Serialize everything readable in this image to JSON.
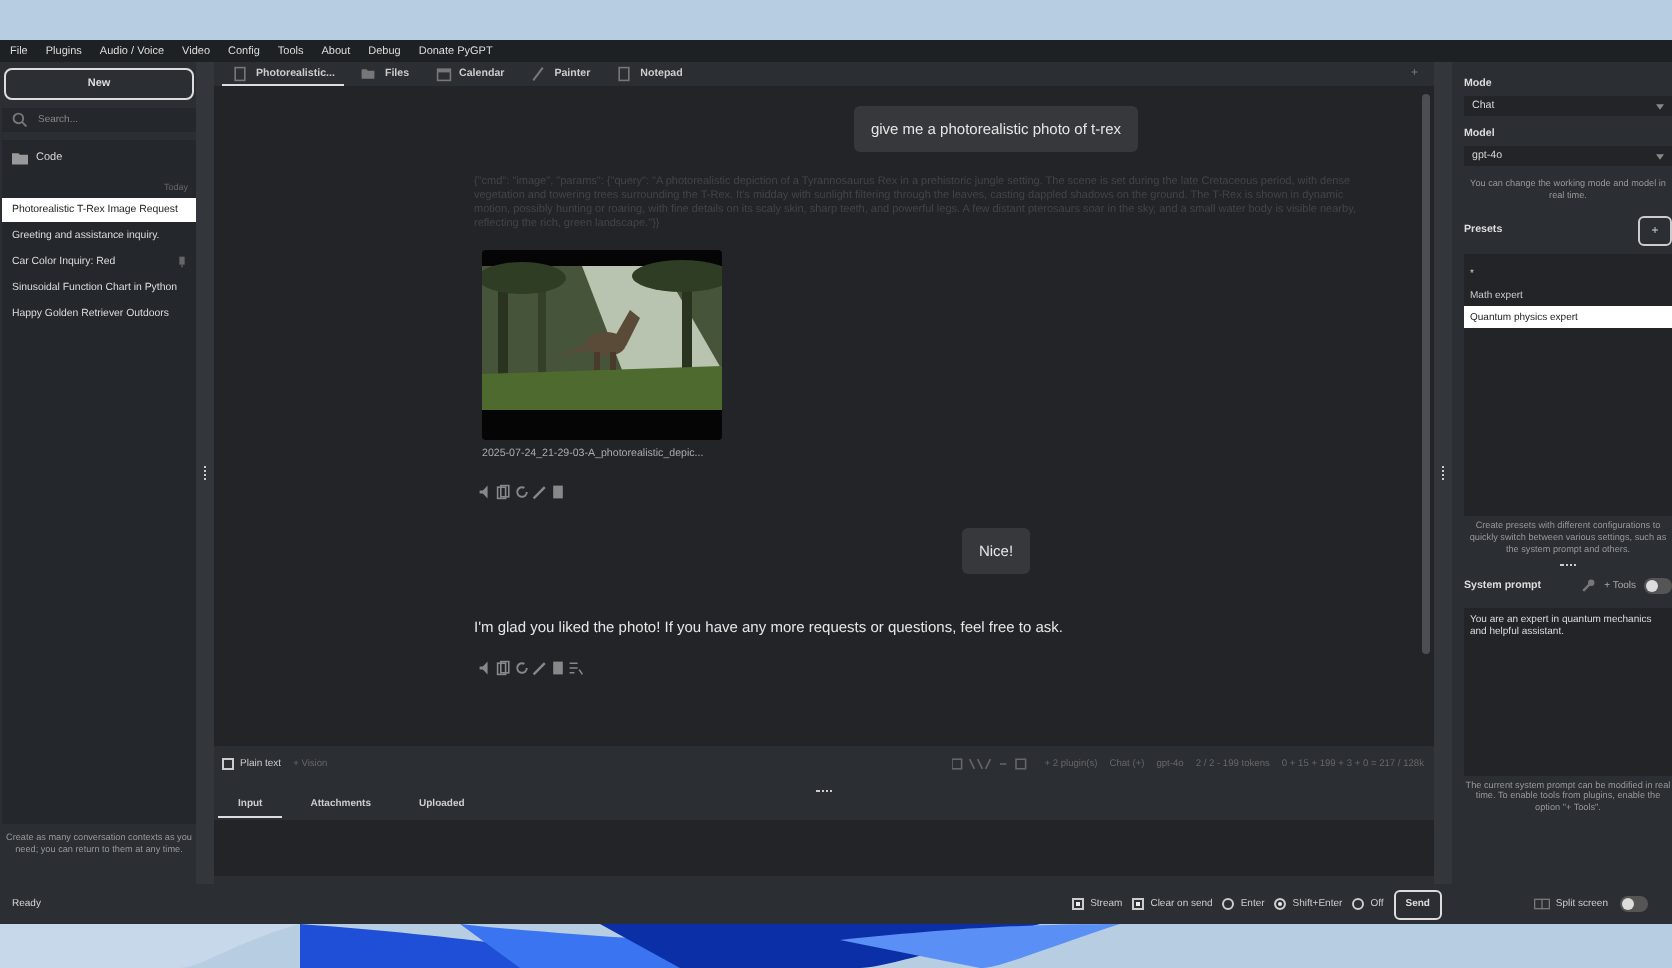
{
  "menu": [
    "File",
    "Plugins",
    "Audio / Voice",
    "Video",
    "Config",
    "Tools",
    "About",
    "Debug",
    "Donate PyGPT"
  ],
  "sidebar": {
    "new_button": "New",
    "search": {
      "placeholder": "Search..."
    },
    "folder": "Code",
    "group_label": "Today",
    "items": [
      {
        "title": "Photorealistic T-Rex Image Request",
        "selected": true,
        "pinned": false
      },
      {
        "title": "Greeting and assistance inquiry.",
        "selected": false,
        "pinned": false
      },
      {
        "title": "Car Color Inquiry: Red",
        "selected": false,
        "pinned": true
      },
      {
        "title": "Sinusoidal Function Chart in Python",
        "selected": false,
        "pinned": false
      },
      {
        "title": "Happy Golden Retriever Outdoors",
        "selected": false,
        "pinned": false
      }
    ],
    "footer": "Create as many conversation contexts as you need; you can return to them at any time."
  },
  "tabs": [
    {
      "label": "Photorealistic...",
      "kind": "chat",
      "selected": true
    },
    {
      "label": "Files",
      "kind": "folder",
      "selected": false
    },
    {
      "label": "Calendar",
      "kind": "calendar",
      "selected": false
    },
    {
      "label": "Painter",
      "kind": "brush",
      "selected": false
    },
    {
      "label": "Notepad",
      "kind": "note",
      "selected": false
    }
  ],
  "tab_add": "+",
  "messages": [
    {
      "kind": "user",
      "text": "give me a photorealistic photo of t-rex"
    },
    {
      "kind": "command",
      "text": "{\"cmd\": \"image\", \"params\": {\"query\": \"A photorealistic depiction of a Tyrannosaurus Rex in a prehistoric jungle setting. The scene is set during the late Cretaceous period, with dense vegetation and towering trees surrounding the T-Rex. It's midday with sunlight filtering through the leaves, casting dappled shadows on the ground. The T-Rex is shown in dynamic motion, possibly hunting or roaring, with fine details on its scaly skin, sharp teeth, and powerful legs. A few distant pterosaurs soar in the sky, and a small water body is visible nearby, reflecting the rich, green landscape.\"}}"
    },
    {
      "caption": "2025-07-24_21-29-03-A_photorealistic_depic...",
      "actions": [
        {
          "kind": "speaker"
        },
        {
          "kind": "copy"
        },
        {
          "kind": "reload"
        },
        {
          "kind": "edit"
        },
        {
          "kind": "delete"
        }
      ]
    },
    {
      "kind": "user",
      "text": "Nice!"
    },
    {
      "kind": "assistant",
      "text": "I'm glad you liked the photo! If you have any more requests or questions, feel free to ask.",
      "actions": [
        {
          "kind": "speaker"
        },
        {
          "kind": "copy"
        },
        {
          "kind": "reload"
        },
        {
          "kind": "edit"
        },
        {
          "kind": "delete"
        },
        {
          "kind": "text"
        }
      ]
    }
  ],
  "toolbar": {
    "plain_text": {
      "label": "Plain text",
      "checked": false
    },
    "vision": "+ Vision",
    "plugins": "+ 2 plugin(s)",
    "mode": "Chat (+)",
    "model": "gpt-4o",
    "tokens": "2 / 2 - 199 tokens",
    "usage": "0 + 15 + 199 + 3 + 0 = 217 / 128k"
  },
  "input_tabs": [
    {
      "label": "Input",
      "selected": true
    },
    {
      "label": "Attachments",
      "selected": false
    },
    {
      "label": "Uploaded",
      "selected": false
    }
  ],
  "status": "Ready",
  "send_options": [
    {
      "label": "Stream",
      "kind": "checkbox",
      "checked": true
    },
    {
      "label": "Clear on send",
      "kind": "checkbox",
      "checked": true
    },
    {
      "label": "Enter",
      "kind": "radio",
      "checked": false
    },
    {
      "label": "Shift+Enter",
      "kind": "radio",
      "checked": true
    },
    {
      "label": "Off",
      "kind": "radio",
      "checked": false
    }
  ],
  "send_button": "Send",
  "right": {
    "mode_label": "Mode",
    "mode": "Chat",
    "model_label": "Model",
    "model": "gpt-4o",
    "model_hint": "You can change the working mode and model in real time.",
    "presets_label": "Presets",
    "presets_add": "+",
    "presets": [
      {
        "name": "*",
        "selected": false
      },
      {
        "name": "Math expert",
        "selected": false
      },
      {
        "name": "Quantum physics expert",
        "selected": true
      }
    ],
    "presets_hint": "Create presets with different configurations to quickly switch between various settings, such as the system prompt and others.",
    "system_label": "System prompt",
    "tools_label": "+ Tools",
    "tools_on": false,
    "system_prompt": "You are an expert in quantum mechanics and helpful assistant.",
    "system_hint": "The current system prompt can be modified in real time. To enable tools from plugins, enable the option \"+ Tools\".",
    "split_label": "Split screen",
    "split_on": false
  }
}
